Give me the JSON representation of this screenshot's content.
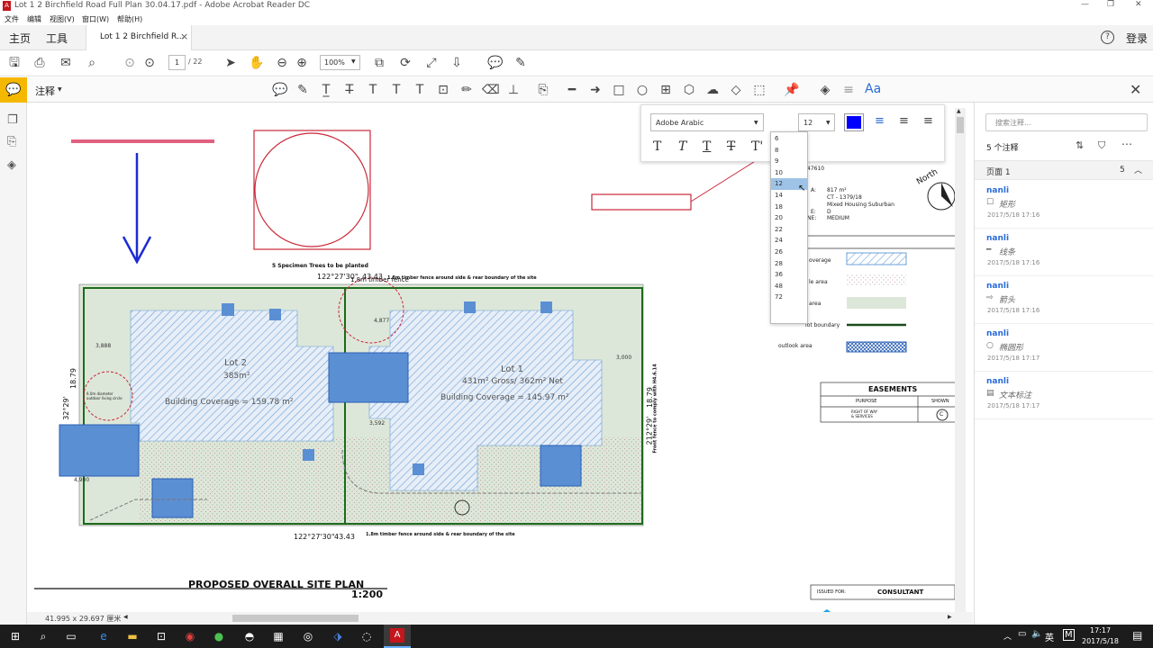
{
  "window": {
    "title": "Lot 1 2 Birchfield Road Full Plan 30.04.17.pdf - Adobe Acrobat Reader DC",
    "controls": [
      "—",
      "❐",
      "✕"
    ]
  },
  "menu": [
    "文件",
    "编辑",
    "视图(V)",
    "窗口(W)",
    "帮助(H)"
  ],
  "tabs": {
    "home": "主页",
    "tools": "工具",
    "doc": "Lot 1 2 Birchfield R...",
    "close": "×",
    "help": "?",
    "login": "登录"
  },
  "toolbar": {
    "page_current": "1",
    "page_total": "/ 22",
    "zoom": "100%"
  },
  "comment_toolbar": {
    "label": "注释",
    "aa": "Aa"
  },
  "font_popup": {
    "font": "Adobe Arabic",
    "size": "12",
    "size_options": [
      "6",
      "8",
      "9",
      "10",
      "12",
      "14",
      "18",
      "20",
      "22",
      "24",
      "26",
      "28",
      "36",
      "48",
      "72"
    ],
    "selected": "12",
    "color": "#0000ff"
  },
  "right_panel": {
    "search_placeholder": "搜索注释...",
    "count_label": "5 个注释",
    "page_label": "页面 1",
    "page_count": "5",
    "comments": [
      {
        "author": "nanli",
        "icon": "☐",
        "type": "矩形",
        "time": "2017/5/18  17:16"
      },
      {
        "author": "nanli",
        "icon": "━",
        "type": "线条",
        "time": "2017/5/18  17:16"
      },
      {
        "author": "nanli",
        "icon": "⇨",
        "type": "箭头",
        "time": "2017/5/18  17:16"
      },
      {
        "author": "nanli",
        "icon": "○",
        "type": "椭圆形",
        "time": "2017/5/18  17:17"
      },
      {
        "author": "nanli",
        "icon": "▤",
        "type": "文本标注",
        "time": "2017/5/18  17:17"
      }
    ]
  },
  "plan": {
    "title": "PROPOSED OVERALL SITE PLAN",
    "scale": "1:200",
    "lot1": "Lot 1",
    "lot1_area": "431m² Gross/ 362m² Net",
    "lot1_cov": "Building Coverage = 145.97 m²",
    "lot2": "Lot 2",
    "lot2_area": "385m²",
    "lot2_cov": "Building Coverage = 159.78 m²",
    "trees": "5 Specimen Trees to be planted",
    "bearing_top": "122°27'30\"",
    "dist_top": "43.43",
    "bearing_bottom": "122°27'30\"",
    "dist_bottom": "43.43",
    "fence_top": "1.8m timber fence around side & rear boundary of the site",
    "fence_bottom": "1.8m timber fence around side & rear boundary of the site",
    "left_dist": "18.79",
    "left_bearing": "32°29'",
    "right_dist": "18.79",
    "right_bearing": "212°29'",
    "front_fence": "Front fence to comply with H4.6.14",
    "circle_label": "6.0m diameter outdoor living circle",
    "legend": {
      "north": "North",
      "num": "47610",
      "area_val": "817 m²",
      "ct": "CT - 1379/18",
      "zone": "Mixed Housing Suburban",
      "d": "D",
      "medium": "MEDIUM",
      "a": "A:",
      "e": "E:",
      "ne": "NE:",
      "coverage": "overage",
      "le_area": "le area",
      "area": "area",
      "lot_boundary": "lot boundary",
      "outlook": "outlook area"
    },
    "easements": {
      "title": "EASEMENTS",
      "purpose": "PURPOSE",
      "shown": "SHOWN",
      "row": "RIGHT OF WAY\n& SERVICES",
      "mark": "C"
    },
    "issued_for": "ISSUED FOR:",
    "consultant": "CONSULTANT"
  },
  "status": {
    "size": "41.995 x 29.697 厘米"
  },
  "taskbar": {
    "lang": "英",
    "ime": "M",
    "time": "17:17",
    "date": "2017/5/18"
  }
}
